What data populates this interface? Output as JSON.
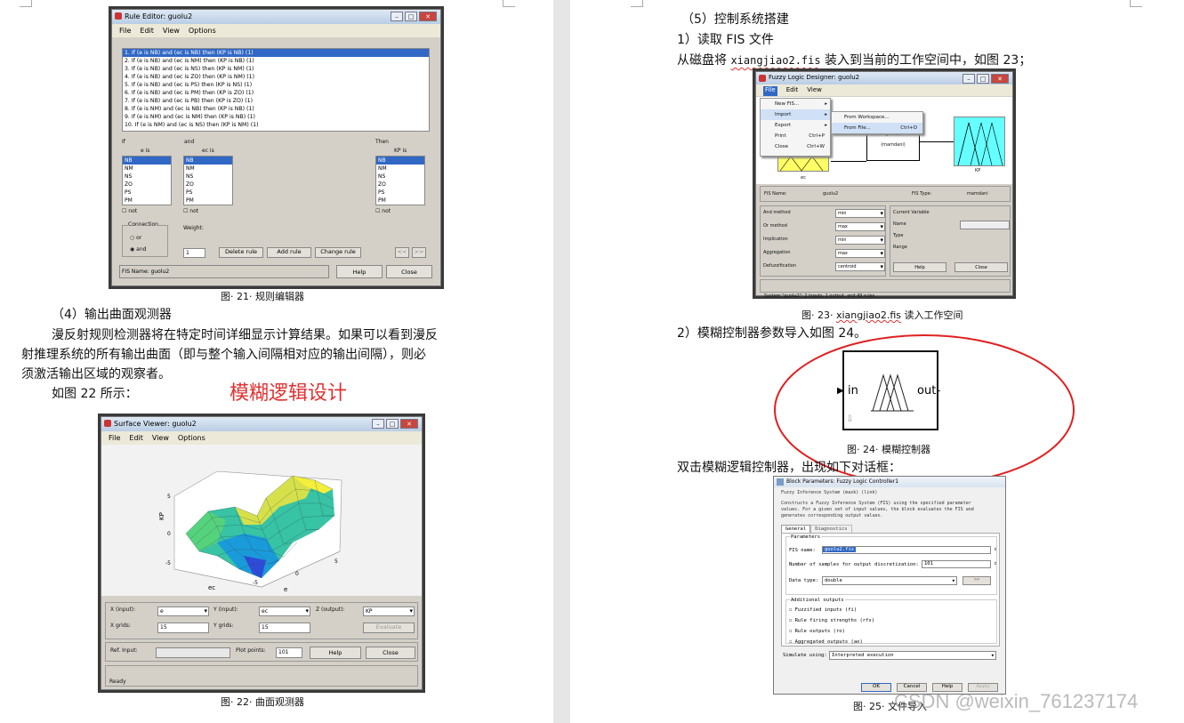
{
  "left": {
    "fig21": {
      "window_title": "Rule Editor: guolu2",
      "menu": [
        "File",
        "Edit",
        "View",
        "Options"
      ],
      "rules": [
        "1. If (e is NB) and (ec is NB) then (KP is NB) (1)",
        "2. If (e is NB) and (ec is NM) then (KP is NB) (1)",
        "3. If (e is NB) and (ec is NS) then (KP is NM) (1)",
        "4. If (e is NB) and (ec is ZO) then (KP is NM) (1)",
        "5. If (e is NB) and (ec is PS) then (KP is NS) (1)",
        "6. If (e is NB) and (ec is PM) then (KP is ZO) (1)",
        "7. If (e is NB) and (ec is PB) then (KP is ZO) (1)",
        "8. If (e is NM) and (ec is NB) then (KP is NB) (1)",
        "9. If (e is NM) and (ec is NM) then (KP is NB) (1)",
        "10. If (e is NM) and (ec is NS) then (KP is NM) (1)"
      ],
      "if_label": "If",
      "and_label": "and",
      "then_label": "Then",
      "var_e": "e is",
      "var_ec": "ec is",
      "var_kp": "KP is",
      "mf_list": [
        "NB",
        "NM",
        "NS",
        "ZO",
        "PS",
        "PM"
      ],
      "not_label": "not",
      "connection_label": "Connection",
      "or_label": "or",
      "and_option": "and",
      "weight_label": "Weight:",
      "weight_value": "1",
      "delete_rule": "Delete rule",
      "add_rule": "Add rule",
      "change_rule": "Change rule",
      "prev": "<<",
      "next": ">>",
      "status": "FIS Name: guolu2",
      "help": "Help",
      "close": "Close",
      "caption": "图· 21· 规则编辑器"
    },
    "sec4_heading": "（4）输出曲面观测器",
    "para_line1": "漫反射规则检测器将在特定时间详细显示计算结果。如果可以看到漫反",
    "para_line2": "射推理系统的所有输出曲面（即与整个输入间隔相对应的输出间隔），则必",
    "para_line3": "须激活输出区域的观察者。",
    "para_line4": "如图 22 所示：",
    "red_title": "模糊逻辑设计",
    "red_color": "#e03030",
    "fig22": {
      "window_title": "Surface Viewer: guolu2",
      "menu": [
        "File",
        "Edit",
        "View",
        "Options"
      ],
      "z_axis": "KP",
      "x_axis": "ec",
      "y_axis": "e",
      "ticks": [
        "5",
        "0",
        "-5",
        "5",
        "0",
        "-5"
      ],
      "x_input_label": "X (input):",
      "x_input_value": "e",
      "y_input_label": "Y (input):",
      "y_input_value": "ec",
      "z_output_label": "Z (output):",
      "z_output_value": "KP",
      "x_grids_label": "X grids:",
      "x_grids_value": "15",
      "y_grids_label": "Y grids:",
      "y_grids_value": "15",
      "evaluate": "Evaluate",
      "ref_input_label": "Ref. Input:",
      "plot_points_label": "Plot points:",
      "plot_points_value": "101",
      "help": "Help",
      "close": "Close",
      "status": "Ready",
      "caption": "图· 22· 曲面观测器"
    }
  },
  "right": {
    "sec5_heading": "（5）控制系统搭建",
    "step1": "1）读取 FIS 文件",
    "step1_text_a": "从磁盘将 ",
    "step1_file": "xiangjiao2.fis",
    "step1_text_b": " 装入到当前的工作空间中，如图 23；",
    "fig23": {
      "window_title": "Fuzzy Logic Designer: guolu2",
      "menu": [
        "File",
        "Edit",
        "View"
      ],
      "file_menu": [
        "New FIS...",
        "Import",
        "Export",
        "Print",
        "Close"
      ],
      "file_shortcuts": [
        "",
        "",
        "",
        "Ctrl+P",
        "Ctrl+W"
      ],
      "import_sub": [
        "From Workspace...",
        "From File..."
      ],
      "import_sub_shortcut": "Ctrl+O",
      "center_name": "guolu2",
      "center_type": "(mamdani)",
      "input_label": "ec",
      "output_label": "KP",
      "fis_name_label": "FIS Name:",
      "fis_name_value": "guolu2",
      "fis_type_label": "FIS Type:",
      "fis_type_value": "mamdani",
      "methods": [
        {
          "label": "And method",
          "value": "min"
        },
        {
          "label": "Or method",
          "value": "max"
        },
        {
          "label": "Implication",
          "value": "min"
        },
        {
          "label": "Aggregation",
          "value": "max"
        },
        {
          "label": "Defuzzification",
          "value": "centroid"
        }
      ],
      "current_variable": "Current Variable",
      "cv_name": "Name",
      "cv_type": "Type",
      "cv_range": "Range",
      "help": "Help",
      "close": "Close",
      "status": "System \"guolu2\": 2 inputs, 1 output, and 49 rules",
      "caption_a": "图· 23· ",
      "caption_file": "xiangjiao2.fis",
      "caption_b": " 读入工作空间"
    },
    "step2": "2）模糊控制器参数导入如图 24。",
    "fig24": {
      "in_label": "in",
      "out_label": "out",
      "caption": "图· 24· 模糊控制器",
      "ellipse_color": "#e02020"
    },
    "dblclick_text": "双击模糊逻辑控制器，出现如下对话框：",
    "fig25": {
      "window_title": "Block Parameters: Fuzzy Logic Controller1",
      "subtitle": "Fuzzy Inference System (mask) (link)",
      "desc1": "Constructs a Fuzzy Inference System (FIS) using the specified parameter",
      "desc2": "values. For a given set of input values, the block evaluates the FIS and",
      "desc3": "generates corresponding output values.",
      "tabs": [
        "General",
        "Diagnostics"
      ],
      "parameters": "Parameters",
      "fis_name_label": "FIS name:",
      "fis_name_value": "guolu2.fis",
      "samples_label": "Number of samples for output discretization:",
      "samples_value": "101",
      "data_type_label": "Data type:",
      "data_type_value": "double",
      "data_type_btn": ">>",
      "additional_outputs": "Additional outputs",
      "checkboxes": [
        "Fuzzified inputs (fi)",
        "Rule firing strengths (rfs)",
        "Rule outputs (ro)",
        "Aggregated outputs (ao)"
      ],
      "simulate_label": "Simulate using:",
      "simulate_value": "Interpreted execution",
      "ok": "OK",
      "cancel": "Cancel",
      "help": "Help",
      "apply": "Apply",
      "caption": "图· 25· 文件导入"
    },
    "watermark": "CSDN @weixin_761237174"
  }
}
